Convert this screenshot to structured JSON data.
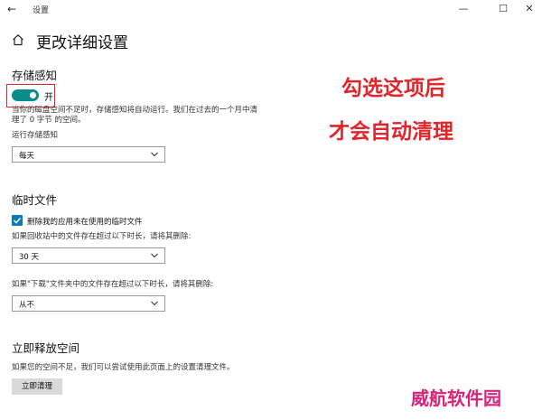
{
  "window": {
    "title": "设置",
    "back_glyph": "←",
    "min_glyph": "—",
    "max_glyph": "☐",
    "close_glyph": "✕"
  },
  "page": {
    "title": "更改详细设置"
  },
  "storage_sense": {
    "heading": "存储感知",
    "toggle_label": "开",
    "toggle_on": true,
    "desc_line1": "当你的磁盘空间不足时，存储感知将自动运行。我们在过去的一个月中清",
    "desc_line2": "理了 0 字节 的空间。",
    "run_label": "运行存储感知",
    "run_value": "每天"
  },
  "temp_files": {
    "heading": "临时文件",
    "checkbox_label": "删除我的应用未在使用的临时文件",
    "checked": true,
    "recycle_label": "如果回收站中的文件存在超过以下时长，请将其删除:",
    "recycle_value": "30 天",
    "downloads_label": "如果\"下载\"文件夹中的文件存在超过以下时长，请将其删除:",
    "downloads_value": "从不"
  },
  "free_space": {
    "heading": "立即释放空间",
    "desc": "如果您的空间不足，我们可以尝试使用此页面上的设置清理文件。",
    "button_label": "立即清理"
  },
  "annotation": {
    "line1": "勾选这项后",
    "line2": "才会自动清理",
    "color": "#e0262b"
  },
  "watermark": {
    "text": "威航软件园",
    "color": "#d6257b"
  },
  "colors": {
    "accent": "#0a8c8c",
    "checkbox": "#0a7ab8"
  }
}
